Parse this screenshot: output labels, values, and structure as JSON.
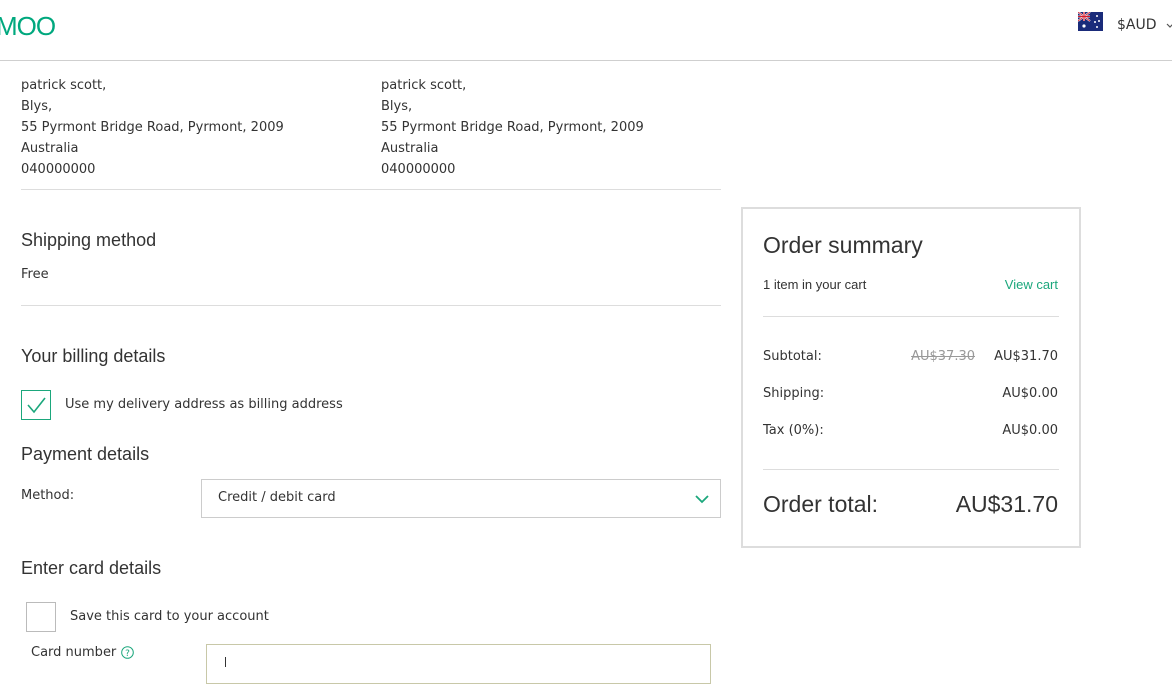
{
  "header": {
    "logo": "MOO",
    "currency": "$AUD",
    "flag_icon": "australia-flag-icon",
    "chevron_icon": "chevron-down-icon"
  },
  "delivery_address": {
    "lines": [
      "patrick scott,",
      "Blys,",
      "55 Pyrmont Bridge Road, Pyrmont, 2009",
      "Australia",
      "040000000"
    ]
  },
  "billing_address": {
    "lines": [
      "patrick scott,",
      "Blys,",
      "55 Pyrmont Bridge Road, Pyrmont, 2009",
      "Australia",
      "040000000"
    ]
  },
  "shipping": {
    "title": "Shipping method",
    "value": "Free"
  },
  "billing": {
    "title": "Your billing details",
    "use_delivery_label": "Use my delivery address as billing address",
    "use_delivery_checked": true
  },
  "payment": {
    "title": "Payment details",
    "method_label": "Method:",
    "method_value": "Credit / debit card"
  },
  "card": {
    "title": "Enter card details",
    "save_label": "Save this card to your account",
    "save_checked": false,
    "number_label": "Card number",
    "number_value": ""
  },
  "summary": {
    "title": "Order summary",
    "items_text": "1 item in your cart",
    "view_cart": "View cart",
    "subtotal_label": "Subtotal:",
    "subtotal_original": "AU$37.30",
    "subtotal_value": "AU$31.70",
    "shipping_label": "Shipping:",
    "shipping_value": "AU$0.00",
    "tax_label": "Tax (0%):",
    "tax_value": "AU$0.00",
    "total_label": "Order total:",
    "total_value": "AU$31.70"
  },
  "colors": {
    "brand": "#00a87e",
    "accent": "#1ba77c"
  }
}
